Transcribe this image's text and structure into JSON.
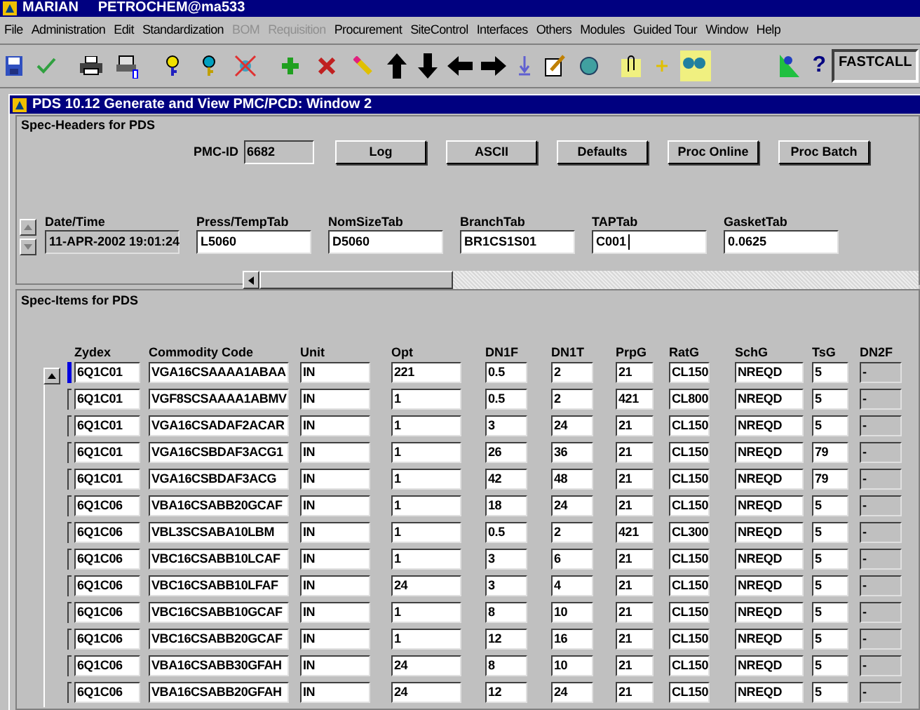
{
  "window": {
    "title": "MARIAN     PETROCHEM@ma533"
  },
  "menu": [
    {
      "label": "File",
      "disabled": false
    },
    {
      "label": "Administration",
      "disabled": false
    },
    {
      "label": "Edit",
      "disabled": false
    },
    {
      "label": "Standardization",
      "disabled": false
    },
    {
      "label": "BOM",
      "disabled": true
    },
    {
      "label": "Requisition",
      "disabled": true
    },
    {
      "label": "Procurement",
      "disabled": false
    },
    {
      "label": "SiteControl",
      "disabled": false
    },
    {
      "label": "Interfaces",
      "disabled": false
    },
    {
      "label": "Others",
      "disabled": false
    },
    {
      "label": "Modules",
      "disabled": false
    },
    {
      "label": "Guided Tour",
      "disabled": false
    },
    {
      "label": "Window",
      "disabled": false
    },
    {
      "label": "Help",
      "disabled": false
    }
  ],
  "toolbar": {
    "help_mark": "?",
    "fastcall": "FASTCALL"
  },
  "child_window": {
    "title": "PDS 10.12 Generate and View PMC/PCD: Window 2"
  },
  "spec_headers": {
    "title": "Spec-Headers for PDS",
    "pmc_id_label": "PMC-ID",
    "pmc_id": "6682",
    "buttons": [
      "Log",
      "ASCII",
      "Defaults",
      "Proc Online",
      "Proc Batch"
    ],
    "fields": [
      {
        "label": "Date/Time",
        "value": "11-APR-2002 19:01:24",
        "disabled": true
      },
      {
        "label": "Press/TempTab",
        "value": "L5060",
        "disabled": false
      },
      {
        "label": "NomSizeTab",
        "value": "D5060",
        "disabled": false
      },
      {
        "label": "BranchTab",
        "value": "BR1CS1S01",
        "disabled": false
      },
      {
        "label": "TAPTab",
        "value": "C001",
        "disabled": false,
        "focused": true
      },
      {
        "label": "GasketTab",
        "value": "0.0625",
        "disabled": false
      }
    ]
  },
  "spec_items": {
    "title": "Spec-Items for PDS",
    "columns": [
      "Zydex",
      "Commodity Code",
      "Unit",
      "Opt",
      "DN1F",
      "DN1T",
      "PrpG",
      "RatG",
      "SchG",
      "TsG",
      "DN2F"
    ],
    "rows": [
      {
        "selected": true,
        "cells": [
          "6Q1C01",
          "VGA16CSAAAA1ABAA",
          "IN",
          "221",
          "0.5",
          "2",
          "21",
          "CL150",
          "NREQD",
          "5",
          "-"
        ]
      },
      {
        "selected": false,
        "cells": [
          "6Q1C01",
          "VGF8SCSAAAA1ABMV",
          "IN",
          "1",
          "0.5",
          "2",
          "421",
          "CL800",
          "NREQD",
          "5",
          "-"
        ]
      },
      {
        "selected": false,
        "cells": [
          "6Q1C01",
          "VGA16CSADAF2ACAR",
          "IN",
          "1",
          "3",
          "24",
          "21",
          "CL150",
          "NREQD",
          "5",
          "-"
        ]
      },
      {
        "selected": false,
        "cells": [
          "6Q1C01",
          "VGA16CSBDAF3ACG1",
          "IN",
          "1",
          "26",
          "36",
          "21",
          "CL150",
          "NREQD",
          "79",
          "-"
        ]
      },
      {
        "selected": false,
        "cells": [
          "6Q1C01",
          "VGA16CSBDAF3ACG",
          "IN",
          "1",
          "42",
          "48",
          "21",
          "CL150",
          "NREQD",
          "79",
          "-"
        ]
      },
      {
        "selected": false,
        "cells": [
          "6Q1C06",
          "VBA16CSABB20GCAF",
          "IN",
          "1",
          "18",
          "24",
          "21",
          "CL150",
          "NREQD",
          "5",
          "-"
        ]
      },
      {
        "selected": false,
        "cells": [
          "6Q1C06",
          "VBL3SCSABA10LBM",
          "IN",
          "1",
          "0.5",
          "2",
          "421",
          "CL300",
          "NREQD",
          "5",
          "-"
        ]
      },
      {
        "selected": false,
        "cells": [
          "6Q1C06",
          "VBC16CSABB10LCAF",
          "IN",
          "1",
          "3",
          "6",
          "21",
          "CL150",
          "NREQD",
          "5",
          "-"
        ]
      },
      {
        "selected": false,
        "cells": [
          "6Q1C06",
          "VBC16CSABB10LFAF",
          "IN",
          "24",
          "3",
          "4",
          "21",
          "CL150",
          "NREQD",
          "5",
          "-"
        ]
      },
      {
        "selected": false,
        "cells": [
          "6Q1C06",
          "VBC16CSABB10GCAF",
          "IN",
          "1",
          "8",
          "10",
          "21",
          "CL150",
          "NREQD",
          "5",
          "-"
        ]
      },
      {
        "selected": false,
        "cells": [
          "6Q1C06",
          "VBC16CSABB20GCAF",
          "IN",
          "1",
          "12",
          "16",
          "21",
          "CL150",
          "NREQD",
          "5",
          "-"
        ]
      },
      {
        "selected": false,
        "cells": [
          "6Q1C06",
          "VBA16CSABB30GFAH",
          "IN",
          "24",
          "8",
          "10",
          "21",
          "CL150",
          "NREQD",
          "5",
          "-"
        ]
      },
      {
        "selected": false,
        "cells": [
          "6Q1C06",
          "VBA16CSABB20GFAH",
          "IN",
          "24",
          "12",
          "24",
          "21",
          "CL150",
          "NREQD",
          "5",
          "-"
        ]
      }
    ]
  }
}
